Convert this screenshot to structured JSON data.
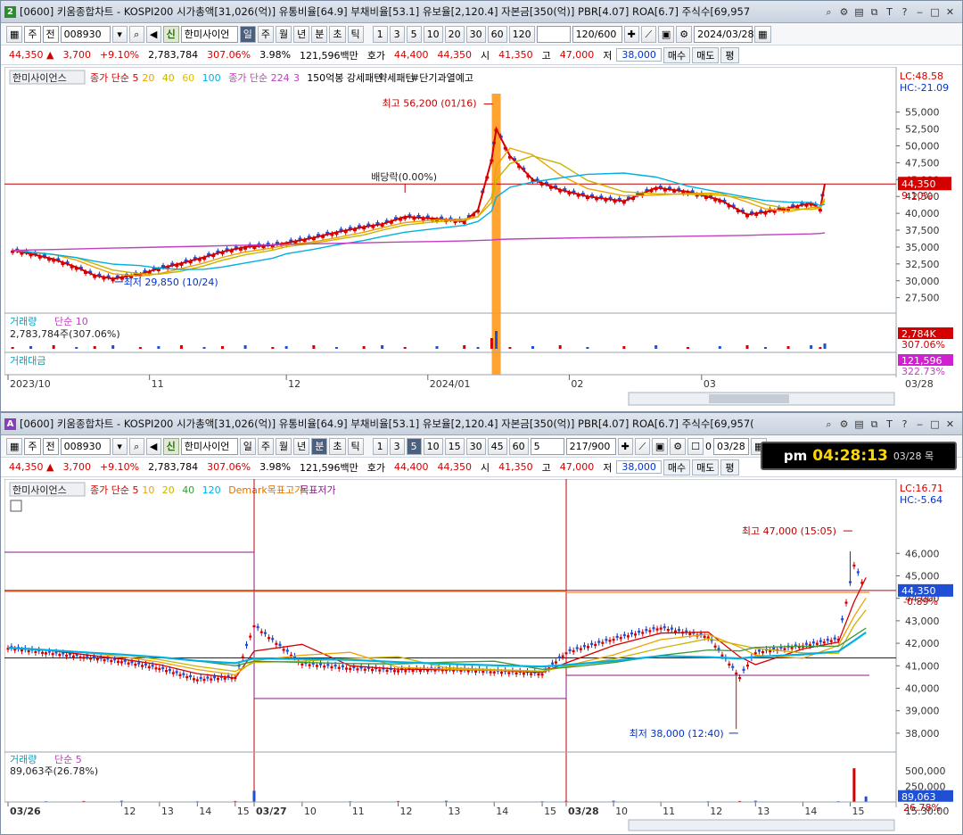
{
  "windows": [
    {
      "badge": "2",
      "title": "[0600] 키움종합차트 - KOSPI200 시가총액[31,026(억)] 유통비율[64.9] 부채비율[53.1] 유보율[2,120.4] 자본금[350(억)] PBR[4.07] ROA[6.7] 주식수[69,957",
      "toolbar": {
        "market": "주",
        "price_type": "전",
        "code": "008930",
        "new_badge": "신",
        "name": "한미사이언",
        "periods": [
          "일",
          "주",
          "월",
          "년",
          "분",
          "초",
          "틱"
        ],
        "active_period": "일",
        "minutes": [
          "1",
          "3",
          "5",
          "10",
          "20",
          "30",
          "60",
          "120"
        ],
        "count": "120/600",
        "date": "2024/03/28"
      },
      "price": {
        "last": "44,350",
        "arrow": "▲",
        "change": "3,700",
        "change_pct": "+9.10%",
        "volume": "2,783,784",
        "vol_ratio": "307.06%",
        "turnover": "3.98%",
        "value": "121,596백만",
        "ask_label": "호가",
        "ask": "44,400",
        "bid": "44,350",
        "open_label": "시",
        "open": "41,350",
        "high_label": "고",
        "high": "47,000",
        "low_label": "저",
        "low": "38,000",
        "buy_label": "매수",
        "sell_label": "매도",
        "eval_label": "평"
      }
    },
    {
      "badge": "A",
      "title": "[0600] 키움종합차트 - KOSPI200 시가총액[31,026(억)] 유통비율[64.9] 부채비율[53.1] 유보율[2,120.4] 자본금[350(억)] PBR[4.07] ROA[6.7] 주식수[69,957(",
      "toolbar": {
        "market": "주",
        "price_type": "전",
        "code": "008930",
        "new_badge": "신",
        "name": "한미사이언",
        "periods": [
          "일",
          "주",
          "월",
          "년",
          "분",
          "초",
          "틱"
        ],
        "active_period": "분",
        "minutes": [
          "1",
          "3",
          "5",
          "10",
          "15",
          "30",
          "45",
          "60"
        ],
        "minute_value": "5",
        "count": "217/900",
        "check_label": "0",
        "date": "03/28"
      },
      "price": {
        "last": "44,350",
        "arrow": "▲",
        "change": "3,700",
        "change_pct": "+9.10%",
        "volume": "2,783,784",
        "vol_ratio": "307.06%",
        "turnover": "3.98%",
        "value": "121,596백만",
        "ask_label": "호가",
        "ask": "44,400",
        "bid": "44,350",
        "open_label": "시",
        "open": "41,350",
        "high_label": "고",
        "high": "47,000",
        "low_label": "저",
        "low": "38,000",
        "buy_label": "매수",
        "sell_label": "매도",
        "eval_label": "평"
      },
      "clock": {
        "ampm": "pm",
        "time": "04:28:13",
        "date": "03/28 목"
      }
    }
  ],
  "chart_data": [
    {
      "type": "candlestick",
      "name_label": "한미사이언스",
      "legend": [
        {
          "text": "종가 단순 5",
          "color": "#d40000"
        },
        {
          "text": "20",
          "color": "#f0a000"
        },
        {
          "text": "40",
          "color": "#c8b400"
        },
        {
          "text": "60",
          "color": "#e0c000"
        },
        {
          "text": "100",
          "color": "#00b0e0"
        },
        {
          "text": "종가 단순 224",
          "color": "#c040c0"
        },
        {
          "text": "3",
          "color": "#c040c0"
        },
        {
          "text": "150억봉 강세패턴",
          "color": "#000"
        },
        {
          "text": "약세패턴",
          "color": "#000"
        },
        {
          "text": "#단기과열예고",
          "color": "#000"
        }
      ],
      "lc_label": "LC:48.58",
      "hc_label": "HC:-21.09",
      "y_ticks": [
        "55,000",
        "52,500",
        "50,000",
        "47,500",
        "45,000",
        "42,500",
        "40,000",
        "37,500",
        "35,000",
        "32,500",
        "30,000",
        "27,500"
      ],
      "ylim": [
        26000,
        58000
      ],
      "x_ticks": [
        "2023/10",
        "11",
        "12",
        "2024/01",
        "02",
        "03",
        "03/28"
      ],
      "x_range": [
        "2023-10-01",
        "2024-03-28"
      ],
      "last_price_tag": "44,350",
      "last_pct_tag": "9.10%",
      "annotations": [
        {
          "text": "최고 56,200 (01/16)",
          "date": "2024-01-16",
          "value": 56200
        },
        {
          "text": "최저 29,850 (10/24)",
          "date": "2023-10-24",
          "value": 29850
        },
        {
          "text": "배당락(0.00%)",
          "date": "2023-12-27",
          "value": 42000
        }
      ],
      "close_series": [
        {
          "date": "2023-10-02",
          "value": 34500
        },
        {
          "date": "2023-10-06",
          "value": 34000
        },
        {
          "date": "2023-10-11",
          "value": 33200
        },
        {
          "date": "2023-10-16",
          "value": 32000
        },
        {
          "date": "2023-10-20",
          "value": 30800
        },
        {
          "date": "2023-10-24",
          "value": 30300
        },
        {
          "date": "2023-10-30",
          "value": 31000
        },
        {
          "date": "2023-11-03",
          "value": 31800
        },
        {
          "date": "2023-11-08",
          "value": 32600
        },
        {
          "date": "2023-11-13",
          "value": 33500
        },
        {
          "date": "2023-11-17",
          "value": 34300
        },
        {
          "date": "2023-11-22",
          "value": 35000
        },
        {
          "date": "2023-11-28",
          "value": 35300
        },
        {
          "date": "2023-12-01",
          "value": 35600
        },
        {
          "date": "2023-12-07",
          "value": 36400
        },
        {
          "date": "2023-12-12",
          "value": 37200
        },
        {
          "date": "2023-12-18",
          "value": 38000
        },
        {
          "date": "2023-12-22",
          "value": 38400
        },
        {
          "date": "2023-12-27",
          "value": 39500
        },
        {
          "date": "2024-01-03",
          "value": 39200
        },
        {
          "date": "2024-01-09",
          "value": 38800
        },
        {
          "date": "2024-01-12",
          "value": 40500
        },
        {
          "date": "2024-01-15",
          "value": 48000
        },
        {
          "date": "2024-01-16",
          "value": 52500
        },
        {
          "date": "2024-01-19",
          "value": 48500
        },
        {
          "date": "2024-01-24",
          "value": 45000
        },
        {
          "date": "2024-01-30",
          "value": 43500
        },
        {
          "date": "2024-02-05",
          "value": 42500
        },
        {
          "date": "2024-02-13",
          "value": 41800
        },
        {
          "date": "2024-02-20",
          "value": 43800
        },
        {
          "date": "2024-02-27",
          "value": 43200
        },
        {
          "date": "2024-03-05",
          "value": 42000
        },
        {
          "date": "2024-03-11",
          "value": 39800
        },
        {
          "date": "2024-03-15",
          "value": 40200
        },
        {
          "date": "2024-03-20",
          "value": 40800
        },
        {
          "date": "2024-03-25",
          "value": 41500
        },
        {
          "date": "2024-03-27",
          "value": 40650
        },
        {
          "date": "2024-03-28",
          "value": 44350
        }
      ],
      "volume_panel": {
        "label": "거래량",
        "ma_label": "단순 10",
        "value_text": "2,783,784주(307.06%)",
        "tag": "2,784K",
        "tag_pct": "307.06%"
      },
      "amount_panel": {
        "label": "거래대금",
        "tag": "121,596",
        "tag_pct": "322.73%"
      }
    },
    {
      "type": "candlestick",
      "name_label": "한미사이언스",
      "legend": [
        {
          "text": "종가 단순 5",
          "color": "#d40000"
        },
        {
          "text": "10",
          "color": "#f0a000"
        },
        {
          "text": "20",
          "color": "#c8b400"
        },
        {
          "text": "40",
          "color": "#3a9a3a"
        },
        {
          "text": "120",
          "color": "#00b0e0"
        },
        {
          "text": "Demark목표고가",
          "color": "#e07000"
        },
        {
          "text": "목표저가",
          "color": "#8a1a8a"
        }
      ],
      "lc_label": "LC:16.71",
      "hc_label": "HC:-5.64",
      "y_ticks": [
        "46,000",
        "45,000",
        "44,000",
        "43,000",
        "42,000",
        "41,000",
        "40,000",
        "39,000",
        "38,000"
      ],
      "ylim": [
        37400,
        47400
      ],
      "x_ticks": [
        "03/26",
        "12",
        "13",
        "14",
        "15",
        "03/27",
        "10",
        "11",
        "12",
        "13",
        "14",
        "15",
        "03/28",
        "10",
        "11",
        "12",
        "13",
        "14",
        "15",
        "15:30:00"
      ],
      "last_price_tag": "44,350",
      "last_pct_tag": "-0.89%",
      "annotations": [
        {
          "text": "최고 47,000 (15:05)",
          "time": "03/28 15:05",
          "value": 47000
        },
        {
          "text": "최저 38,000 (12:40)",
          "time": "03/28 12:40",
          "value": 38000
        }
      ],
      "close_series": [
        {
          "time": "03/26 09:00",
          "value": 41800
        },
        {
          "time": "03/26 10:00",
          "value": 41600
        },
        {
          "time": "03/26 11:00",
          "value": 41400
        },
        {
          "time": "03/26 12:00",
          "value": 41200
        },
        {
          "time": "03/26 13:00",
          "value": 40900
        },
        {
          "time": "03/26 14:00",
          "value": 40400
        },
        {
          "time": "03/26 15:00",
          "value": 40500
        },
        {
          "time": "03/27 09:00",
          "value": 42800
        },
        {
          "time": "03/27 10:00",
          "value": 41100
        },
        {
          "time": "03/27 11:00",
          "value": 40900
        },
        {
          "time": "03/27 12:00",
          "value": 40800
        },
        {
          "time": "03/27 13:00",
          "value": 40850
        },
        {
          "time": "03/27 14:00",
          "value": 40750
        },
        {
          "time": "03/27 15:00",
          "value": 40650
        },
        {
          "time": "03/28 09:00",
          "value": 41600
        },
        {
          "time": "03/28 10:00",
          "value": 42200
        },
        {
          "time": "03/28 11:00",
          "value": 42700
        },
        {
          "time": "03/28 12:00",
          "value": 42300
        },
        {
          "time": "03/28 12:40",
          "value": 40500
        },
        {
          "time": "03/28 13:00",
          "value": 41600
        },
        {
          "time": "03/28 14:00",
          "value": 41900
        },
        {
          "time": "03/28 14:45",
          "value": 42200
        },
        {
          "time": "03/28 15:05",
          "value": 45500
        },
        {
          "time": "03/28 15:20",
          "value": 44350
        }
      ],
      "volume_panel": {
        "label": "거래량",
        "ma_label": "단순 5",
        "value_text": "89,063주(26.78%)",
        "y_ticks": [
          "500,000",
          "250,000"
        ],
        "tag": "89,063",
        "tag_pct": "26.78%"
      }
    }
  ]
}
